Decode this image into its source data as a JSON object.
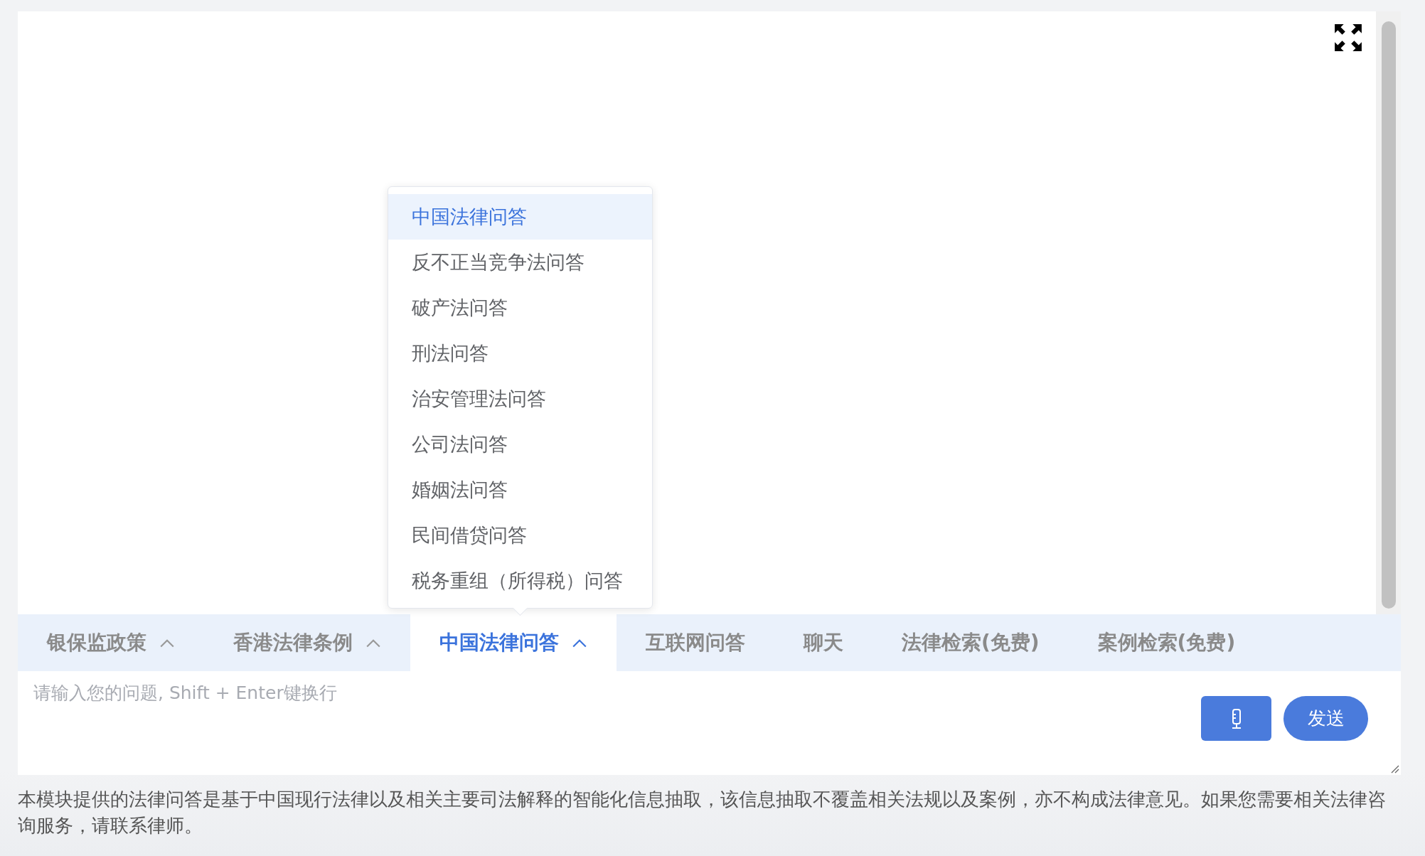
{
  "dropdown": {
    "items": [
      {
        "label": "中国法律问答",
        "selected": true
      },
      {
        "label": "反不正当竞争法问答",
        "selected": false
      },
      {
        "label": "破产法问答",
        "selected": false
      },
      {
        "label": "刑法问答",
        "selected": false
      },
      {
        "label": "治安管理法问答",
        "selected": false
      },
      {
        "label": "公司法问答",
        "selected": false
      },
      {
        "label": "婚姻法问答",
        "selected": false
      },
      {
        "label": "民间借贷问答",
        "selected": false
      },
      {
        "label": "税务重组（所得税）问答",
        "selected": false
      }
    ]
  },
  "tabs": [
    {
      "label": "银保监政策",
      "selected": false,
      "has_menu": true
    },
    {
      "label": "香港法律条例",
      "selected": false,
      "has_menu": true
    },
    {
      "label": "中国法律问答",
      "selected": true,
      "has_menu": true
    },
    {
      "label": "互联网问答",
      "selected": false,
      "has_menu": false
    },
    {
      "label": "聊天",
      "selected": false,
      "has_menu": false
    },
    {
      "label": "法律检索(免费)",
      "selected": false,
      "has_menu": false
    },
    {
      "label": "案例检索(免费)",
      "selected": false,
      "has_menu": false
    }
  ],
  "input": {
    "placeholder": "请输入您的问题, Shift + Enter键换行"
  },
  "send_button": "发送",
  "disclaimer": "本模块提供的法律问答是基于中国现行法律以及相关主要司法解释的智能化信息抽取，该信息抽取不覆盖相关法规以及案例，亦不构成法律意见。如果您需要相关法律咨询服务，请联系律师。"
}
